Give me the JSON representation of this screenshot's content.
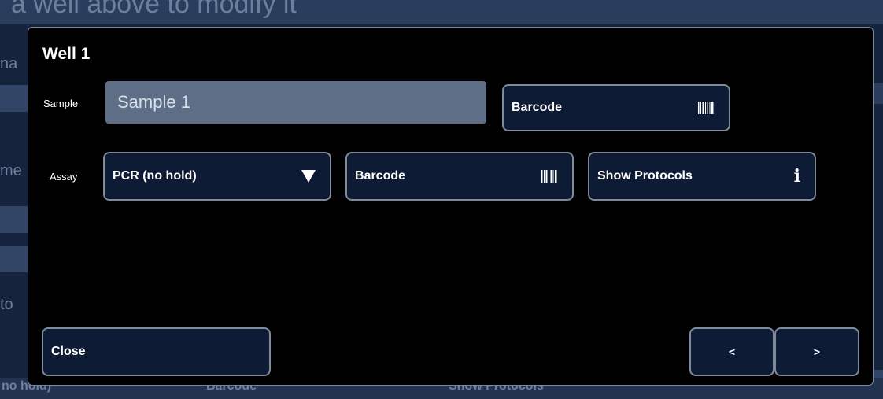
{
  "background": {
    "heading": "a well above to modify it",
    "labels": [
      "na",
      "me",
      "to"
    ],
    "bottom_row": {
      "assay": "no hold)",
      "barcode": "Barcode",
      "show_protocols": "Show Protocols"
    }
  },
  "dialog": {
    "title": "Well 1",
    "sample": {
      "label": "Sample",
      "value": "Sample 1",
      "barcode_label": "Barcode"
    },
    "assay": {
      "label": "Assay",
      "selected": "PCR (no hold)",
      "barcode_label": "Barcode",
      "show_protocols_label": "Show Protocols"
    },
    "close_label": "Close",
    "prev_label": "<",
    "next_label": ">"
  },
  "icons": {
    "barcode": "barcode-icon",
    "dropdown": "caret-down-icon",
    "info": "info-icon"
  },
  "colors": {
    "dialog_bg": "#000000",
    "button_bg": "#0e1b35",
    "button_border": "#7f8a9a",
    "input_bg": "#5d6e86"
  }
}
